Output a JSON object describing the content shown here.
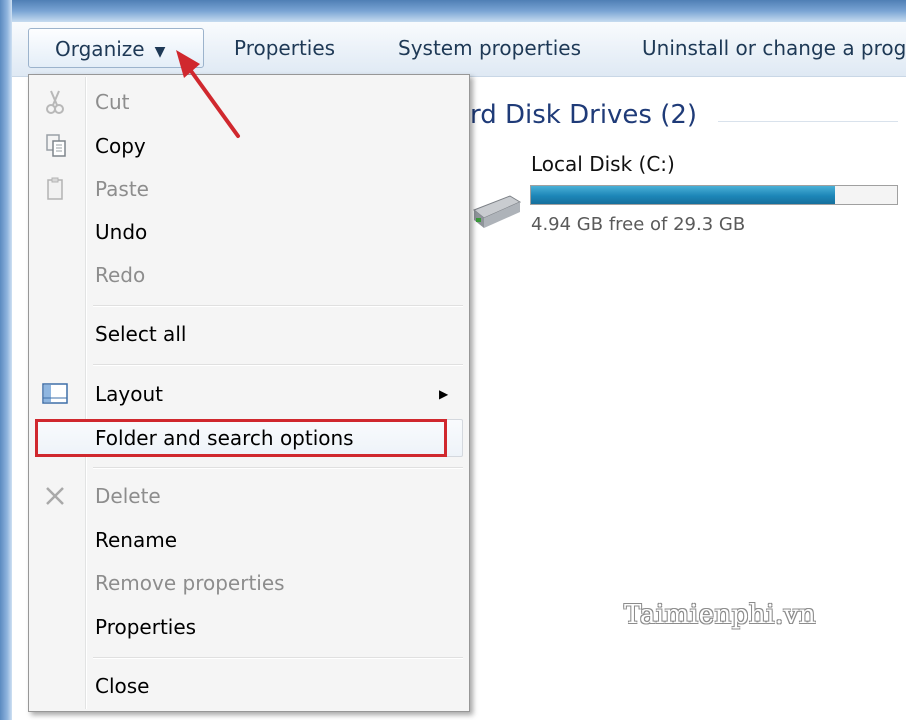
{
  "toolbar": {
    "organize_label": "Organize",
    "properties_label": "Properties",
    "system_properties_label": "System properties",
    "uninstall_label": "Uninstall or change a prog"
  },
  "content": {
    "section_header": "rd Disk Drives (2)",
    "drive": {
      "name": "Local Disk (C:)",
      "free_text": "4.94 GB free of 29.3 GB",
      "used_fraction": 0.83
    },
    "watermark": "Taimienphi.vn"
  },
  "menu": {
    "items": [
      {
        "label": "Cut",
        "enabled": false,
        "icon": "scissors-icon"
      },
      {
        "label": "Copy",
        "enabled": true,
        "icon": "copy-icon"
      },
      {
        "label": "Paste",
        "enabled": false,
        "icon": "clipboard-icon"
      },
      {
        "label": "Undo",
        "enabled": true
      },
      {
        "label": "Redo",
        "enabled": false
      },
      {
        "label": "Select all",
        "enabled": true
      },
      {
        "label": "Layout",
        "enabled": true,
        "icon": "layout-icon",
        "submenu": true
      },
      {
        "label": "Folder and search options",
        "enabled": true,
        "highlighted": true
      },
      {
        "label": "Delete",
        "enabled": false,
        "icon": "delete-x-icon"
      },
      {
        "label": "Rename",
        "enabled": true
      },
      {
        "label": "Remove properties",
        "enabled": false
      },
      {
        "label": "Properties",
        "enabled": true
      },
      {
        "label": "Close",
        "enabled": true
      }
    ]
  },
  "colors": {
    "annotation_red": "#d0282e",
    "header_blue": "#1f3b78",
    "drive_bar_blue": "#1d86b8"
  }
}
